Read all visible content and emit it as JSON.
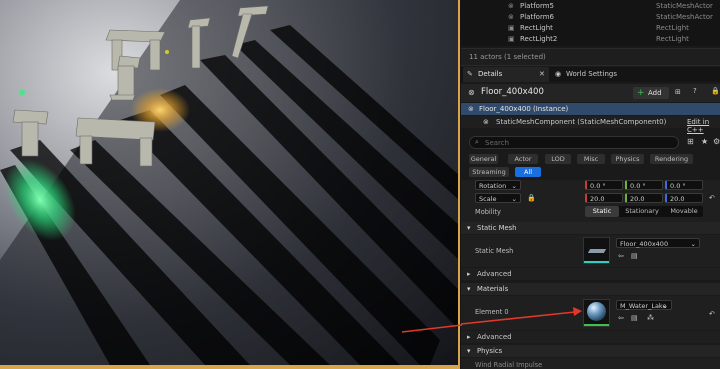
{
  "outliner": {
    "rows": [
      {
        "name": "Platform5",
        "type": "StaticMeshActor"
      },
      {
        "name": "Platform6",
        "type": "StaticMeshActor"
      },
      {
        "name": "RectLight",
        "type": "RectLight"
      },
      {
        "name": "RectLight2",
        "type": "RectLight"
      }
    ],
    "status": "11 actors (1 selected)"
  },
  "tabs": {
    "details": "Details",
    "world_settings": "World Settings"
  },
  "actor": {
    "name": "Floor_400x400",
    "add_label": "Add"
  },
  "components": {
    "instance": "Floor_400x400 (Instance)",
    "child": "StaticMeshComponent (StaticMeshComponent0)",
    "edit_link": "Edit in C++"
  },
  "search": {
    "placeholder": "Search"
  },
  "filters": [
    "General",
    "Actor",
    "LOD",
    "Misc",
    "Physics",
    "Rendering",
    "Streaming",
    "All"
  ],
  "transform": {
    "rotation_label": "Rotation",
    "rotation_values": [
      "0.0 °",
      "0.0 °",
      "0.0 °"
    ],
    "scale_label": "Scale",
    "scale_values": [
      "20.0",
      "20.0",
      "20.0"
    ],
    "mobility_label": "Mobility",
    "mobility_options": [
      "Static",
      "Stationary",
      "Movable"
    ],
    "mobility_selected": "Static"
  },
  "static_mesh_section": {
    "title": "Static Mesh",
    "label": "Static Mesh",
    "value": "Floor_400x400",
    "advanced": "Advanced"
  },
  "materials_section": {
    "title": "Materials",
    "element_label": "Element 0",
    "value": "M_Water_Lake",
    "advanced": "Advanced"
  },
  "physics_section": {
    "title": "Physics",
    "next_label": "Wind Radial Impulse"
  },
  "colors": {
    "accent": "#1a6fe0",
    "add_green": "#3fbf4f",
    "arrow_red": "#e0392b",
    "viewport_border": "#d9a54a"
  }
}
